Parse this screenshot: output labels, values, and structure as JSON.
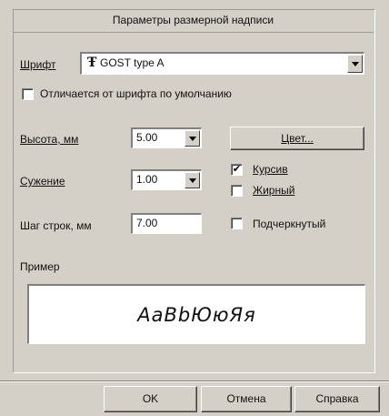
{
  "dialog": {
    "title": "Параметры размерной надписи",
    "font": {
      "label": "Шрифт",
      "icon": "truetype-font-icon",
      "icon_glyph": "Ŧ",
      "value": "GOST type A"
    },
    "differs_checkbox": {
      "label": "Отличается от шрифта по умолчанию",
      "checked": false
    },
    "height": {
      "label": "Высота, мм",
      "value": "5.00"
    },
    "color_button": "Цвет...",
    "narrowing": {
      "label": "Сужение",
      "value": "1.00"
    },
    "line_spacing": {
      "label": "Шаг строк, мм",
      "value": "7.00"
    },
    "style_checkboxes": [
      {
        "label": "Курсив",
        "checked": true,
        "mark": "✔"
      },
      {
        "label": "Жирный",
        "checked": false,
        "mark": ""
      },
      {
        "label": "Подчеркнутый",
        "checked": false,
        "mark": ""
      }
    ],
    "preview": {
      "label": "Пример",
      "text": "АаВbЮюЯя"
    },
    "buttons": {
      "ok": "OK",
      "cancel": "Отмена",
      "help": "Справка"
    }
  }
}
